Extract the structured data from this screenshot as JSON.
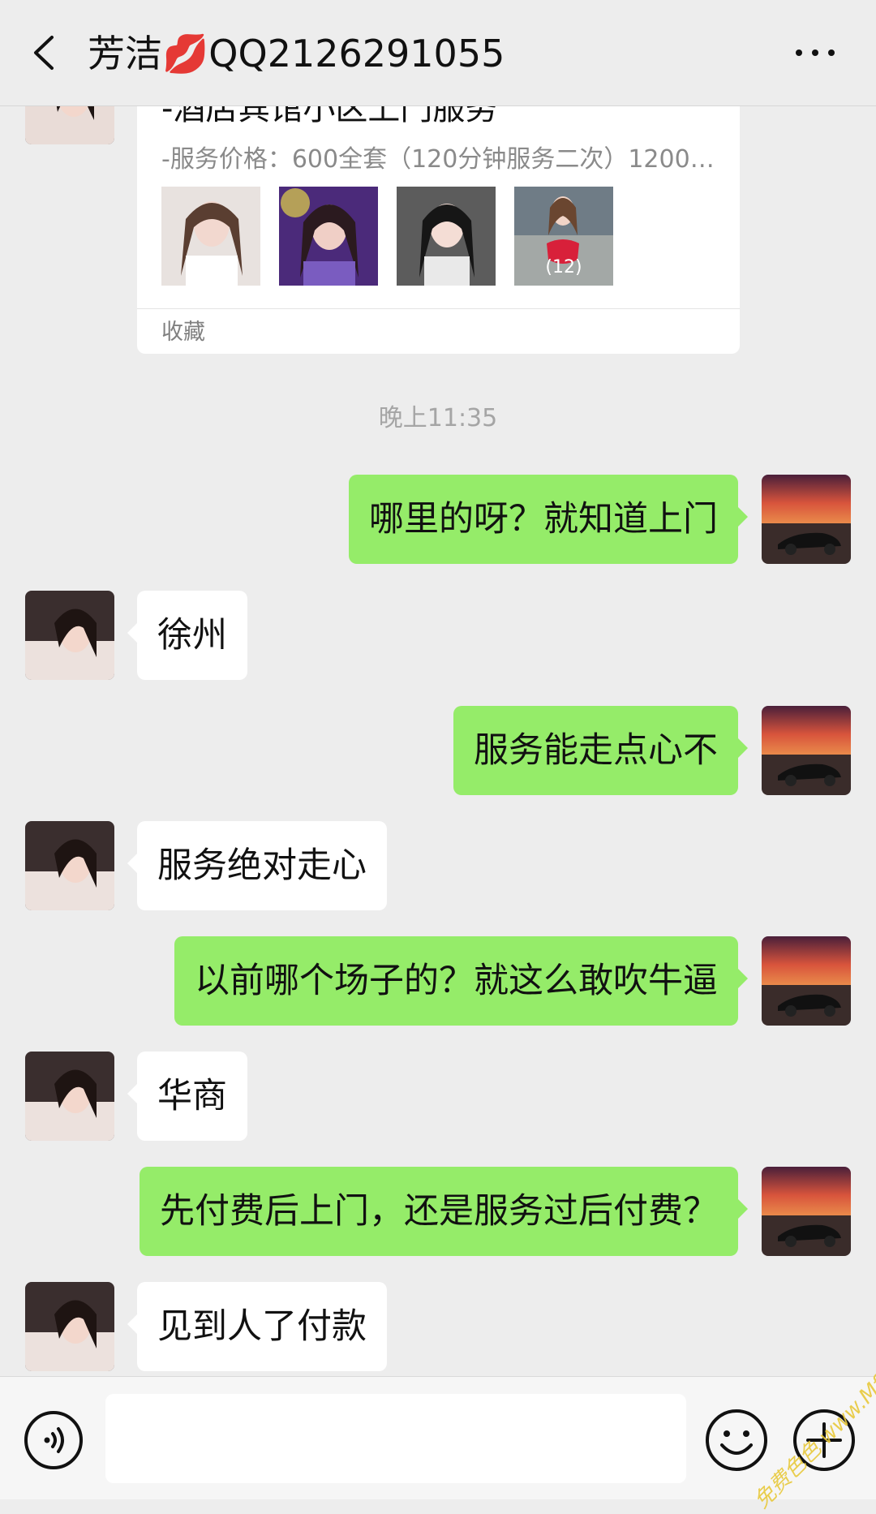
{
  "header": {
    "title": "芳洁💋QQ2126291055"
  },
  "card": {
    "title": "-酒店宾馆小区上门服务",
    "description": "-服务价格：600全套（120分钟服务二次）1200…",
    "image_count": "(12)",
    "footer": "收藏"
  },
  "timestamp": "晚上11:35",
  "messages": [
    {
      "side": "out",
      "text": "哪里的呀？就知道上门"
    },
    {
      "side": "in",
      "text": "徐州"
    },
    {
      "side": "out",
      "text": "服务能走点心不"
    },
    {
      "side": "in",
      "text": "服务绝对走心"
    },
    {
      "side": "out",
      "text": "以前哪个场子的？就这么敢吹牛逼"
    },
    {
      "side": "in",
      "text": "华商"
    },
    {
      "side": "out",
      "text": "先付费后上门，还是服务过后付费？"
    },
    {
      "side": "in",
      "text": "见到人了付款"
    }
  ],
  "input_bar": {
    "placeholder": "",
    "icons": [
      "voice-icon",
      "emoji-icon",
      "plus-icon"
    ]
  },
  "watermark": "免费色色 www.Mfsese.com",
  "colors": {
    "background": "#ededed",
    "outgoing_bubble": "#95ec69",
    "incoming_bubble": "#ffffff"
  }
}
